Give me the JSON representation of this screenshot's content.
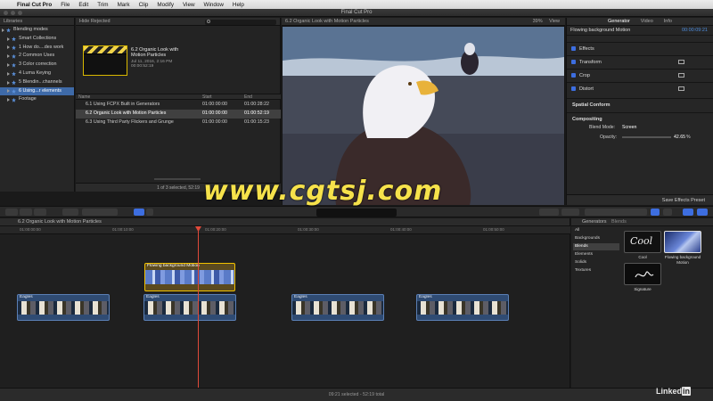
{
  "menubar": {
    "app": "Final Cut Pro",
    "items": [
      "File",
      "Edit",
      "Trim",
      "Mark",
      "Clip",
      "Modify",
      "View",
      "Window",
      "Help"
    ]
  },
  "window": {
    "title": "Final Cut Pro"
  },
  "libraries": {
    "header": "Libraries",
    "items": [
      {
        "label": "Blending modes"
      },
      {
        "label": "Smart Collections"
      },
      {
        "label": "1 How do....des work"
      },
      {
        "label": "2 Common Uses"
      },
      {
        "label": "3 Color correction"
      },
      {
        "label": "4 Luma Keying"
      },
      {
        "label": "5 Blendin...channels"
      },
      {
        "label": "6 Using...r elements"
      },
      {
        "label": "Footage"
      }
    ]
  },
  "browser": {
    "filter": "Hide Rejected",
    "selected_clip": {
      "name_line1": "6.2 Organic Look with",
      "name_line2": "Motion Particles",
      "date": "Jul 11, 2016, 2:16 PM",
      "duration": "00:00:52:19"
    },
    "columns": [
      "Name",
      "Start",
      "End"
    ],
    "rows": [
      {
        "name": "6.1 Using FCPX Built in Generators",
        "start": "01:00:00:00",
        "end": "01:00:28:22"
      },
      {
        "name": "6.2 Organic Look with Motion Particles",
        "start": "01:00:00:00",
        "end": "01:00:52:19"
      },
      {
        "name": "6.3 Using Third Party Flickers and Grunge",
        "start": "01:00:00:00",
        "end": "01:00:15:23"
      }
    ],
    "footer": "1 of 3 selected, 52:19"
  },
  "viewer": {
    "title": "6.2 Organic Look with Motion Particles",
    "zoom": "39%",
    "view_menu": "View"
  },
  "inspector": {
    "tabs": [
      "Generator",
      "Video",
      "Info"
    ],
    "clip_name": "Flowing background Motion",
    "timecode": "00:00:09:21",
    "sections": [
      "Effects",
      "Transform",
      "Crop",
      "Distort"
    ],
    "spatial": "Spatial Conform",
    "compositing": "Compositing",
    "blend_mode_label": "Blend Mode:",
    "blend_mode_value": "Screen",
    "opacity_label": "Opacity:",
    "opacity_value": "42.65",
    "opacity_unit": "%",
    "save_preset": "Save Effects Preset"
  },
  "toolbar": {
    "timecode": ""
  },
  "timeline": {
    "project": "6.2 Organic Look with Motion Particles",
    "ruler": [
      "01:00:00:00",
      "01:00:10:00",
      "01:00:20:00",
      "01:00:30:00",
      "01:00:40:00",
      "01:00:50:00"
    ],
    "generator_clip": "Flowing background Motion",
    "clips": [
      "Eagles",
      "Eagles",
      "Eagles",
      "Eagles"
    ],
    "footer": "09:21 selected - 52:19 total"
  },
  "generators": {
    "header": "Generators",
    "header2": "Blends",
    "categories": [
      "All",
      "Backgrounds",
      "Blends",
      "Elements",
      "Solids",
      "Textures"
    ],
    "thumbs": [
      {
        "label": "Cool"
      },
      {
        "label": "Flowing background Motion"
      },
      {
        "label": "Signature"
      }
    ],
    "cool_glyph": "Cool"
  },
  "overlays": {
    "watermark": "www.cgtsj.com",
    "brand_left": "Linked",
    "brand_right": "in"
  }
}
